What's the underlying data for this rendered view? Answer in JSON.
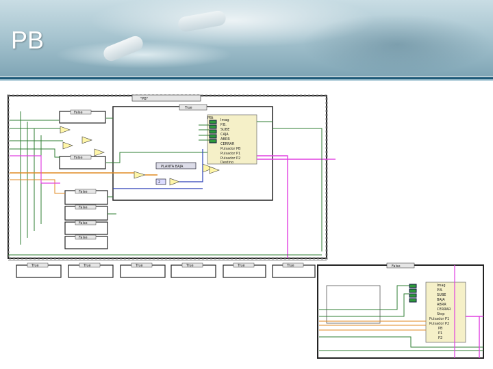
{
  "slide": {
    "title": "PB"
  },
  "diagram": {
    "upper_case_selector": "\"PB\"",
    "inner_case_selector": "True",
    "cluster_label": "PBt",
    "cluster_items": [
      "Imag",
      "P.B.",
      "SUBE",
      "CAJA",
      "ABRR",
      "CERRAR",
      "Pulsador PB",
      "Pulsador P1",
      "Pulsador P2",
      "Destino"
    ],
    "enum_constant": "PLANTA BAJA",
    "numeric_constant": "2",
    "left_case_labels": [
      "False",
      "False",
      "False",
      "False",
      "False",
      "False"
    ],
    "bottom_case_labels": [
      "True",
      "True",
      "True",
      "True",
      "True",
      "True"
    ],
    "lower_right_case_selector": "False",
    "lower_right_items": [
      "Imag",
      "P.B.",
      "SUBE",
      "BAJA",
      "ABRR",
      "CERRAR",
      "Stop",
      "Pulsador P1",
      "Pulsador P2",
      "PB",
      "P1",
      "P2"
    ]
  },
  "colors": {
    "wire_pink": "#e040e0",
    "wire_orange": "#e08a20",
    "wire_blue": "#2a3fb8",
    "wire_green": "#2e7d32",
    "cluster_fill": "#f5f0c8"
  }
}
